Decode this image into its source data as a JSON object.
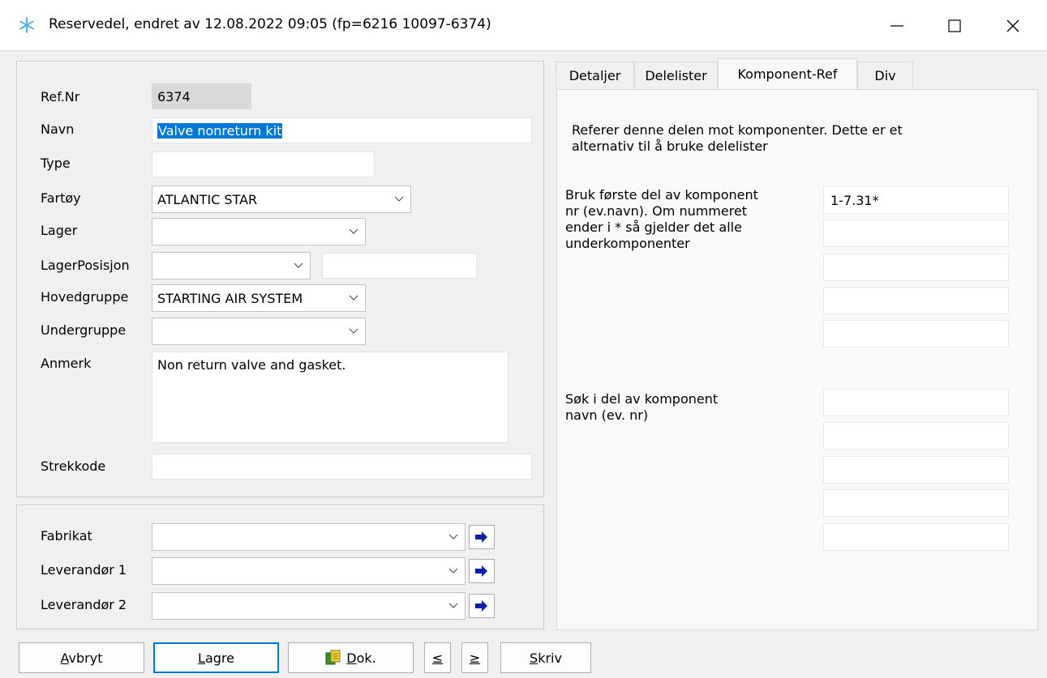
{
  "window": {
    "title": "Reservedel, endret av  12.08.2022 09:05 (fp=6216 10097-6374)",
    "icon": "snowflake-icon"
  },
  "form": {
    "refnr_label": "Ref.Nr",
    "refnr_value": "6374",
    "navn_label": "Navn",
    "navn_value": "Valve nonreturn kit",
    "type_label": "Type",
    "type_value": "",
    "fartoy_label": "Fartøy",
    "fartoy_value": "ATLANTIC STAR",
    "lager_label": "Lager",
    "lager_value": "",
    "lagerposisjon_label": "LagerPosisjon",
    "lagerposisjon_value": "",
    "lagerposisjon_extra": "",
    "hovedgruppe_label": "Hovedgruppe",
    "hovedgruppe_value": "STARTING AIR SYSTEM",
    "undergruppe_label": "Undergruppe",
    "undergruppe_value": "",
    "anmerk_label": "Anmerk",
    "anmerk_value": "Non return valve and gasket.",
    "strekkode_label": "Strekkode",
    "strekkode_value": ""
  },
  "suppliers": {
    "fabrikat_label": "Fabrikat",
    "fabrikat_value": "",
    "leverandor1_label": "Leverandør 1",
    "leverandor1_value": "",
    "leverandor2_label": "Leverandør 2",
    "leverandor2_value": ""
  },
  "tabs": [
    {
      "label": "Detaljer"
    },
    {
      "label": "Delelister"
    },
    {
      "label": "Komponent-Ref"
    },
    {
      "label": "Div"
    }
  ],
  "active_tab": "Komponent-Ref",
  "komponent_ref": {
    "intro_line1": "Referer denne delen mot komponenter. Dette er et",
    "intro_line2": "alternativ til å bruke delelister",
    "bruk_line1": "Bruk første del av komponent",
    "bruk_line2": "nr (ev.navn). Om nummeret",
    "bruk_line3": "ender i * så gjelder det alle",
    "bruk_line4": "underkomponenter",
    "bruk_fields": [
      "1-7.31*",
      "",
      "",
      "",
      ""
    ],
    "sok_line1": "Søk i del av komponent",
    "sok_line2": "navn (ev. nr)",
    "sok_fields": [
      "",
      "",
      "",
      "",
      ""
    ]
  },
  "buttons": {
    "avbryt_first": "A",
    "avbryt_rest": "vbryt",
    "lagre_first": "L",
    "lagre_rest": "agre",
    "dok_first": "D",
    "dok_rest": "ok.",
    "prev": "≤",
    "next": "≥",
    "skriv_first": "S",
    "skriv_rest": "kriv"
  },
  "colors": {
    "selection": "#0078d7",
    "arrow": "#0a1fa8"
  }
}
